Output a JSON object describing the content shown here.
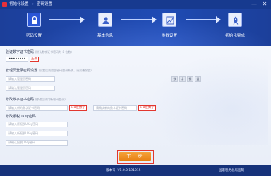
{
  "window": {
    "title": "初始化设置",
    "subtitle": "密码设置",
    "separator": "›",
    "minimize_glyph": "—",
    "close_glyph": "✕"
  },
  "steps": [
    {
      "label": "密码设置",
      "icon": "lock-icon",
      "active": true
    },
    {
      "label": "基本信息",
      "icon": "user-icon",
      "active": false
    },
    {
      "label": "参数设置",
      "icon": "settings-chart-icon",
      "active": false
    },
    {
      "label": "初始化完成",
      "icon": "rocket-icon",
      "active": false
    }
  ],
  "cert_pwd": {
    "title": "验证数字证书密码",
    "hint": "(默认数字证书密码为 8 位数)",
    "value": "••••••••",
    "status": "正确"
  },
  "admin_pwd": {
    "title": "管理员登录密码设置",
    "hint": "(设置后须用此密码登录系统，请妥善保管)",
    "placeholder1": "请输入管理员密码",
    "placeholder2": "请确认管理员密码",
    "keypad": [
      "数",
      "字",
      "键",
      "盘"
    ]
  },
  "modify_cert": {
    "title": "修改数字证书密码",
    "hint": "(修改后须用新密码登录)",
    "placeholder1": "请输入新的数字证书密码",
    "tag1": "6-8位数字",
    "placeholder2": "请确认新的数字证书密码",
    "tag2": "6-8位数字"
  },
  "ukey": {
    "title": "修改报税UKey密码",
    "placeholder1": "请输入原报税UKey密码",
    "placeholder2": "请输入新报税UKey密码",
    "placeholder3": "请确认报税UKey密码"
  },
  "next_button": "下一步",
  "footer": {
    "version": "版本号: V1.0.0 191015",
    "org": "国家税务总局监制"
  },
  "colors": {
    "header_blue": "#1f4bb4",
    "accent_orange": "#e77f12",
    "error_red": "#e2372f"
  }
}
